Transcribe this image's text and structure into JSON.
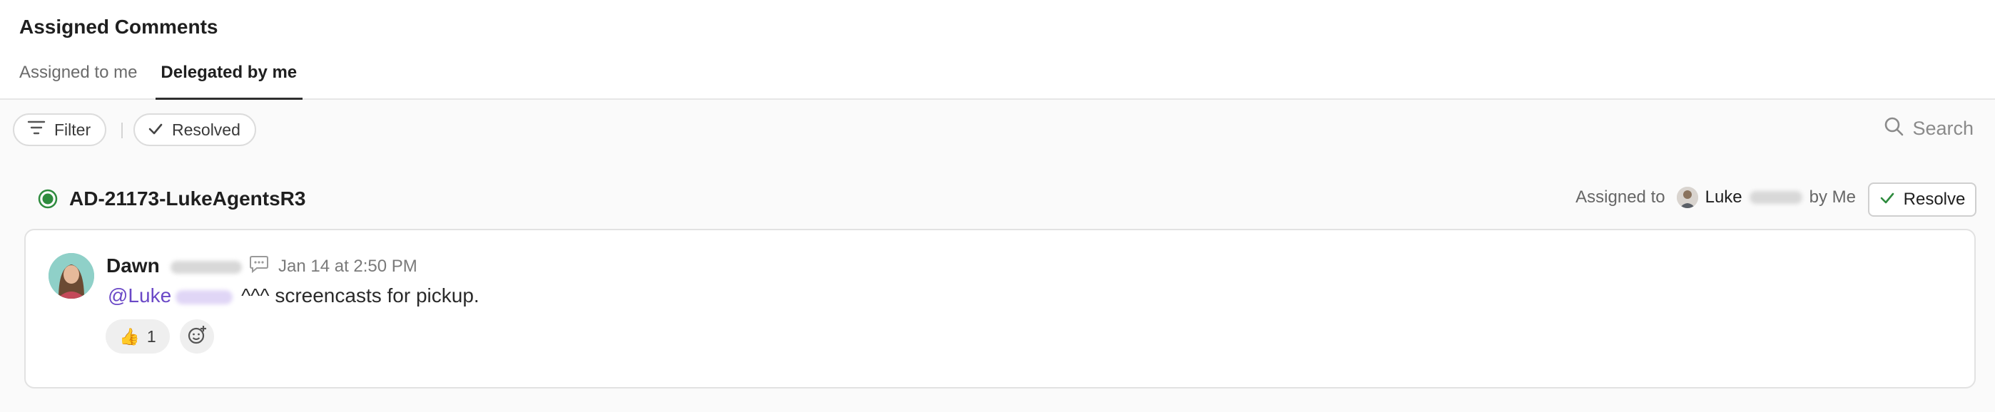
{
  "header": {
    "title": "Assigned Comments",
    "tabs": [
      {
        "label": "Assigned to me",
        "active": false
      },
      {
        "label": "Delegated by me",
        "active": true
      }
    ]
  },
  "toolbar": {
    "filter_label": "Filter",
    "resolved_label": "Resolved",
    "search_label": "Search"
  },
  "thread": {
    "status_color": "#2e8b3e",
    "title": "AD-21173-LukeAgentsR3",
    "assigned_prefix": "Assigned to",
    "assignee_name": "Luke",
    "assigned_suffix": "by Me",
    "resolve_label": "Resolve"
  },
  "comment": {
    "author": "Dawn",
    "timestamp": "Jan 14 at 2:50 PM",
    "mention": "@Luke",
    "text": "^^^ screencasts for pickup.",
    "reaction_emoji": "👍",
    "reaction_count": "1"
  },
  "colors": {
    "accent_mention": "#6b49c7",
    "status_green": "#2e8b3e"
  }
}
